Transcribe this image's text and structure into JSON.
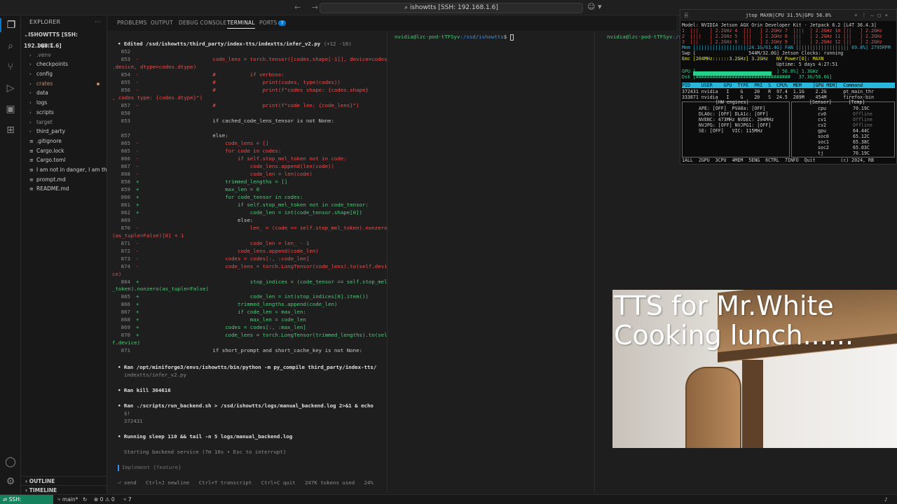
{
  "titlebar": {
    "search": "ishowtts [SSH: 192.168.1.6]",
    "nav": "← →"
  },
  "sidebar": {
    "title": "EXPLORER",
    "root": "ISHOWTTS [SSH: 192.168.1.6]",
    "items": [
      {
        "label": ".agent",
        "kind": "folder"
      },
      {
        "label": ".venv",
        "kind": "folder-dim"
      },
      {
        "label": "checkpoints",
        "kind": "folder"
      },
      {
        "label": "config",
        "kind": "folder"
      },
      {
        "label": "crates",
        "kind": "folder-git"
      },
      {
        "label": "data",
        "kind": "folder"
      },
      {
        "label": "logs",
        "kind": "folder"
      },
      {
        "label": "scripts",
        "kind": "folder"
      },
      {
        "label": "target",
        "kind": "folder-dim"
      },
      {
        "label": "third_party",
        "kind": "folder"
      },
      {
        "label": ".gitignore",
        "kind": "file"
      },
      {
        "label": "Cargo.lock",
        "kind": "file"
      },
      {
        "label": "Cargo.toml",
        "kind": "file"
      },
      {
        "label": "I am not in danger, I am th...",
        "kind": "file"
      },
      {
        "label": "prompt.md",
        "kind": "file"
      },
      {
        "label": "README.md",
        "kind": "file"
      }
    ],
    "outline": "OUTLINE",
    "timeline": "TIMELINE"
  },
  "panel": {
    "tabs": [
      "PROBLEMS",
      "OUTPUT",
      "DEBUG CONSOLE",
      "TERMINAL",
      "PORTS"
    ],
    "ports_count": "7"
  },
  "terminal1": {
    "edited_header": "• Edited /ssd/ishowtts/third_party/index-tts/indextts/infer_v2.py",
    "edited_stats": "(+12 -16)",
    "diff": [
      {
        "ln": "852",
        "sg": "",
        "code": ""
      },
      {
        "ln": "853",
        "sg": "-",
        "code": "            code_lens = torch.tensor([codes.shape[-1]], device=codes"
      },
      {
        "ln": "",
        "sg": "",
        "code": ".device, dtype=codes.dtype)"
      },
      {
        "ln": "854",
        "sg": "-",
        "code": "            #           if verbose:"
      },
      {
        "ln": "855",
        "sg": "-",
        "code": "            #               print(codes, type(codes))"
      },
      {
        "ln": "856",
        "sg": "-",
        "code": "            #               print(f\"codes shape: {codes.shape}"
      },
      {
        "ln": "",
        "sg": "",
        "code": ", codes type: {codes.dtype}\")"
      },
      {
        "ln": "857",
        "sg": "-",
        "code": "            #               print(f\"code len: {code_lens}\")"
      },
      {
        "ln": "858",
        "sg": "",
        "code": ""
      },
      {
        "ln": "853",
        "sg": "",
        "code": "            if cached_code_lens_tensor is not None:"
      },
      {
        "ln": "",
        "sg": "",
        "code": ""
      },
      {
        "ln": "857",
        "sg": "",
        "code": "            else:"
      },
      {
        "ln": "865",
        "sg": "-",
        "code": "                code_lens = []"
      },
      {
        "ln": "865",
        "sg": "-",
        "code": "                for code in codes:"
      },
      {
        "ln": "866",
        "sg": "-",
        "code": "                    if self.stop_mel_token not in code:"
      },
      {
        "ln": "867",
        "sg": "-",
        "code": "                        code_lens.append(len(code))"
      },
      {
        "ln": "868",
        "sg": "-",
        "code": "                        code_len = len(code)"
      },
      {
        "ln": "858",
        "sg": "+",
        "code": "                trimmed_lengths = []"
      },
      {
        "ln": "859",
        "sg": "+",
        "code": "                max_len = 0"
      },
      {
        "ln": "860",
        "sg": "+",
        "code": "                for code_tensor in codes:"
      },
      {
        "ln": "861",
        "sg": "+",
        "code": "                    if self.stop_mel_token not in code_tensor:"
      },
      {
        "ln": "862",
        "sg": "+",
        "code": "                        code_len = int(code_tensor.shape[0])"
      },
      {
        "ln": "869",
        "sg": "",
        "code": "                    else:"
      },
      {
        "ln": "870",
        "sg": "-",
        "code": "                        len_ = (code == self.stop_mel_token).nonzero"
      },
      {
        "ln": "",
        "sg": "",
        "code": "(as_tuple=False)[0] + 1"
      },
      {
        "ln": "871",
        "sg": "-",
        "code": "                        code_len = len_ - 1"
      },
      {
        "ln": "872",
        "sg": "-",
        "code": "                    code_lens.append(code_len)"
      },
      {
        "ln": "873",
        "sg": "-",
        "code": "                codes = codes[:, :code_len]"
      },
      {
        "ln": "874",
        "sg": "-",
        "code": "                code_lens = torch.LongTensor(code_lens).to(self.devi"
      },
      {
        "ln": "",
        "sg": "",
        "code": "ce)"
      },
      {
        "ln": "864",
        "sg": "+",
        "code": "                        stop_indices = (code_tensor == self.stop_mel"
      },
      {
        "ln": "",
        "sg": "",
        "code": "_token).nonzero(as_tuple=False)"
      },
      {
        "ln": "865",
        "sg": "+",
        "code": "                        code_len = int(stop_indices[0].item())"
      },
      {
        "ln": "866",
        "sg": "+",
        "code": "                    trimmed_lengths.append(code_len)"
      },
      {
        "ln": "867",
        "sg": "+",
        "code": "                    if code_len > max_len:"
      },
      {
        "ln": "868",
        "sg": "+",
        "code": "                        max_len = code_len"
      },
      {
        "ln": "869",
        "sg": "+",
        "code": "                codes = codes[:, :max_len]"
      },
      {
        "ln": "870",
        "sg": "+",
        "code": "                code_lens = torch.LongTensor(trimmed_lengths).to(sel"
      },
      {
        "ln": "",
        "sg": "",
        "code": "f.device)"
      },
      {
        "ln": "871",
        "sg": "",
        "code": "            if short_prompt and short_cache_key is not None:"
      }
    ],
    "ran1_a": "• Ran /opt/miniforge3/envs/ishowtts/bin/python -m py_compile third_party/index-tts/",
    "ran1_b": "  indextts/infer_v2.py",
    "ran2": "• Ran kill 364616",
    "ran3_a": "• Ran ./scripts/run_backend.sh > /ssd/ishowtts/logs/manual_backend.log 2>&1 & echo",
    "ran3_b": "  $!",
    "ran3_c": "  372431",
    "running": "• Running sleep 110 && tail -n 5 logs/manual_backend.log",
    "starting": "  Starting backend service (7m 10s • Esc to interrupt)",
    "input_placeholder": "Implement {feature}",
    "hints": "⏎ send   Ctrl+J newline   Ctrl+T transcript   Ctrl+C quit   247K tokens used   24%"
  },
  "terminal2": {
    "user": "nvidia@lzc-pod-tTFSyv",
    "path": ":/ssd/ishowtts",
    "symbol": "$"
  },
  "terminal3": {
    "user": "nvidia@lzc-pod-tTFSyv",
    "path": ":/s"
  },
  "jtop": {
    "title": "jtop MAXN|CPU 31.5%|GPU 56.8%",
    "lines": [
      "Model: NVIDIA Jetson AGX Orin Developer Kit - Jetpack 6.2 [L4T 36.4.3]",
      "1  [||    ] 2.2GHz 4  [||   ] 2.2GHz 7  [|||  ] 2.2GHz 10 [||   ] 2.2GHz",
      "2  [|||   ] 2.2GHz 5  [||   ] 2.2GHz 8  [||   ] 2.2GHz 11 [||   ] 2.2GHz",
      "3  [||    ] 2.2GHz 6  [||   ] 2.2GHz 9  [||   ] 2.2GHz 12 [||   ] 2.2GHz",
      "Mem [|||||||||||||||||||24.1G/61.4G] FAN [|||||||||||||||||| 69.8%] 2795RPM",
      "Swp [                   544M/32.0G] Jetson Clocks: running",
      "Emc [204MHz::::::3.2GHz] 3.2GHz   NV Power[0]: MAXN",
      "                                  Uptime: 5 days 4:27:51",
      "GPU [                             ] 56.8%] 1.3GHz",
      "Dsk [##################################   37.3G/56.6G]"
    ],
    "proc_header": "PID    USER    GPU  TYPE  PRI  S  CPU%  MEM    [GPU MEM]  Command",
    "proc1": "372431 nvidia   I    G    20   R  97.4  1.1G    2.2G      pt_main_thr",
    "proc2": "333871 nvidia   I    G    20   S  24.5  289M    454M      firefox-bin",
    "hw_title": "[HW engines]",
    "hw": [
      "APE: [OFF]  PVA0a: [OFF]",
      "DLA0c: [OFF] DLA1c: [OFF]",
      "NVENC: 473MHz NVDEC: 204MHz",
      "NVJPG: [OFF] NVJPG1: [OFF]",
      "SE: [OFF]   VIC: 115MHz"
    ],
    "sensor_title": "[Sensor]      [Temp]",
    "sensors": [
      {
        "name": "cpu",
        "val": "70.19C"
      },
      {
        "name": "cv0",
        "val": "Offline"
      },
      {
        "name": "cv1",
        "val": "Offline"
      },
      {
        "name": "cv2",
        "val": "Offline"
      },
      {
        "name": "gpu",
        "val": "64.44C"
      },
      {
        "name": "soc0",
        "val": "65.12C"
      },
      {
        "name": "soc1",
        "val": "65.38C"
      },
      {
        "name": "soc2",
        "val": "65.03C"
      },
      {
        "name": "tj",
        "val": "70.19C"
      }
    ],
    "footer": "1ALL  2GPU  3CPU  4MEM  5ENG  6CTRL  7INFO  Quit         (c) 2024, RB"
  },
  "camera": {
    "caption": "TTS for Mr.White\nCooking lunch......"
  },
  "statusbar": {
    "remote": "SSH: 192.168.1.6",
    "branch": "main*",
    "sync": "↻",
    "errors": "⊗ 0  ⚠ 0",
    "ports": "⑂ 7",
    "bell": "🔔"
  }
}
